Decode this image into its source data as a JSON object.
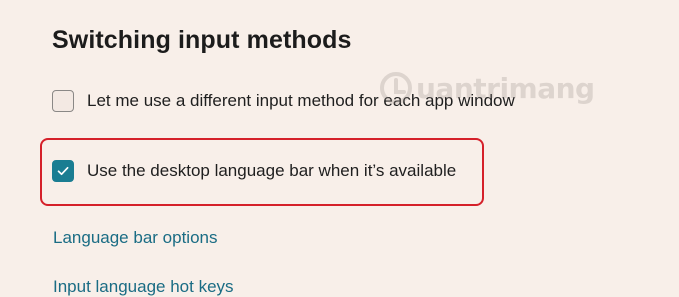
{
  "section": {
    "heading": "Switching input methods"
  },
  "options": [
    {
      "label": "Let me use a different input method for each app window",
      "checked": false
    },
    {
      "label": "Use the desktop language bar when it’s available",
      "checked": true
    }
  ],
  "links": [
    {
      "label": "Language bar options"
    },
    {
      "label": "Input language hot keys"
    }
  ],
  "watermark": {
    "text": "uantrimang"
  },
  "colors": {
    "background": "#f8efe9",
    "accent": "#1a7d92",
    "link": "#1a6c84",
    "highlight": "#d5202a"
  }
}
